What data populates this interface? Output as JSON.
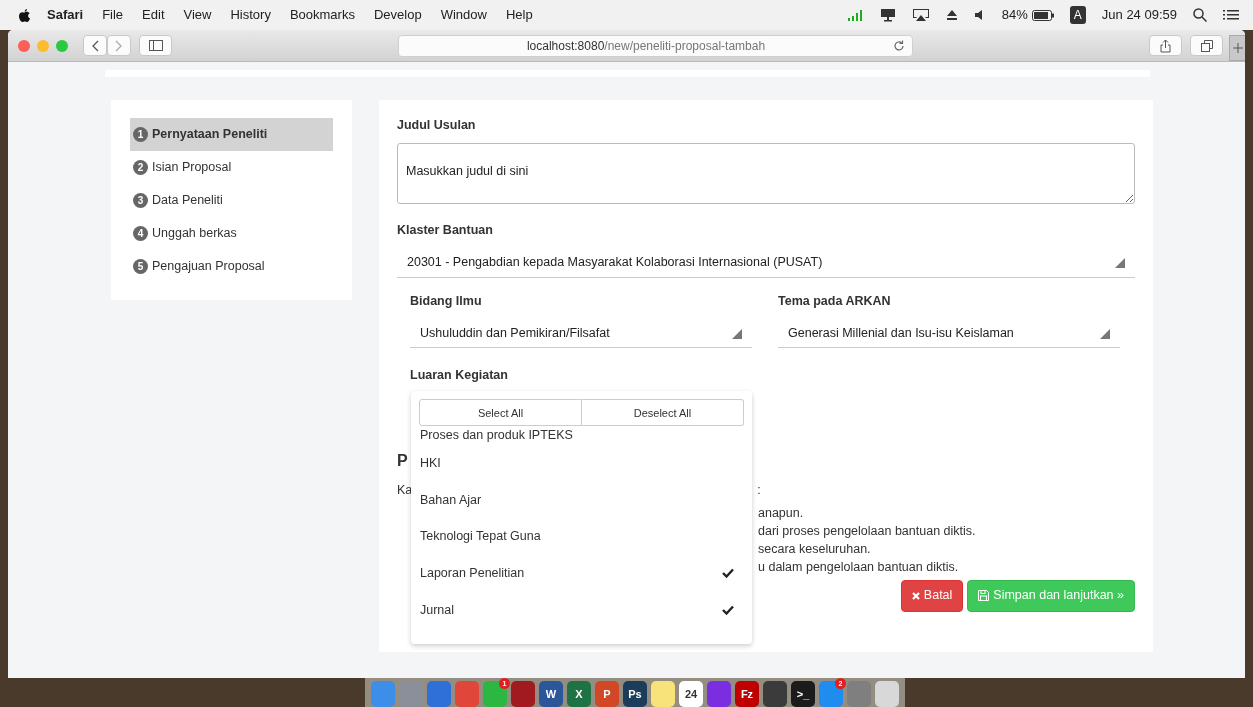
{
  "menubar": {
    "app": "Safari",
    "menus": [
      "File",
      "Edit",
      "View",
      "History",
      "Bookmarks",
      "Develop",
      "Window",
      "Help"
    ],
    "battery": "84%",
    "input_source": "A",
    "clock": "Jun 24 09:59"
  },
  "browser": {
    "url_host": "localhost:8080",
    "url_path": "/new/peneliti-proposal-tambah"
  },
  "steps": [
    {
      "number": "1",
      "label": "Pernyataan Peneliti",
      "selected": true
    },
    {
      "number": "2",
      "label": "Isian Proposal",
      "selected": false
    },
    {
      "number": "3",
      "label": "Data Peneliti",
      "selected": false
    },
    {
      "number": "4",
      "label": "Unggah berkas",
      "selected": false
    },
    {
      "number": "5",
      "label": "Pengajuan Proposal",
      "selected": false
    }
  ],
  "form": {
    "title_label": "Judul Usulan",
    "title_value": "Masukkan judul di sini",
    "cluster_label": "Klaster Bantuan",
    "cluster_value": "20301 - Pengabdian kepada Masyarakat Kolaborasi Internasional (PUSAT)",
    "field_label": "Bidang Ilmu",
    "field_value": "Ushuluddin dan Pemikiran/Filsafat",
    "theme_label": "Tema pada ARKAN",
    "theme_value": "Generasi Millenial dan Isu-isu Keislaman",
    "output_label": "Luaran Kegiatan"
  },
  "output_dropdown": {
    "select_all": "Select All",
    "deselect_all": "Deselect All",
    "options": [
      {
        "label": "Proses dan produk IPTEKS",
        "checked": false
      },
      {
        "label": "HKI",
        "checked": false
      },
      {
        "label": "Bahan Ajar",
        "checked": false
      },
      {
        "label": "Teknologi Tepat Guna",
        "checked": false
      },
      {
        "label": "Laporan Penelitian",
        "checked": true
      },
      {
        "label": "Jurnal",
        "checked": true
      }
    ]
  },
  "statement": {
    "heading": "P",
    "intro": "Ka",
    "intro_end": ":",
    "lines": [
      "anapun.",
      "dari proses pengelolaan bantuan diktis.",
      "secara keseluruhan.",
      "u dalam pengelolaan bantuan diktis."
    ]
  },
  "buttons": {
    "cancel": "Batal",
    "save": "Simpan dan lanjutkan »"
  },
  "dock": [
    {
      "color": "#3d8ee8"
    },
    {
      "color": "#8a8f99"
    },
    {
      "color": "#2f6fd8"
    },
    {
      "color": "#e0463a"
    },
    {
      "color": "#2bb741",
      "badge": "1"
    },
    {
      "color": "#a11a1f"
    },
    {
      "color": "#2b579a",
      "label": "W"
    },
    {
      "color": "#1f7244",
      "label": "X"
    },
    {
      "color": "#d24726",
      "label": "P"
    },
    {
      "color": "#1c3d5a",
      "label": "Ps"
    },
    {
      "color": "#f8e27a"
    },
    {
      "color": "#ffffff",
      "label": "24"
    },
    {
      "color": "#7a2ee0"
    },
    {
      "color": "#bf0000",
      "label": "Fz"
    },
    {
      "color": "#3b3b3b"
    },
    {
      "color": "#1b1b1b",
      "label": ">_"
    },
    {
      "color": "#1f8cf0",
      "badge": "2"
    },
    {
      "color": "#7f7f7f"
    },
    {
      "color": "#d8d8d8"
    }
  ]
}
